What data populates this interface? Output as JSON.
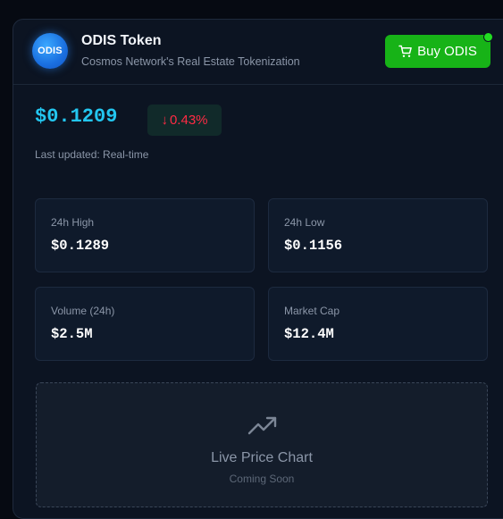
{
  "token": {
    "logo_text": "ODIS",
    "name": "ODIS Token",
    "subtitle": "Cosmos Network's Real Estate Tokenization"
  },
  "actions": {
    "buy_label": "Buy ODIS"
  },
  "price": {
    "value": "$0.1209",
    "change_arrow": "↓",
    "change_pct": "0.43%",
    "updated_label": "Last updated: Real-time"
  },
  "stats": [
    {
      "label": "24h High",
      "value": "$0.1289"
    },
    {
      "label": "24h Low",
      "value": "$0.1156"
    },
    {
      "label": "Volume (24h)",
      "value": "$2.5M"
    },
    {
      "label": "Market Cap",
      "value": "$12.4M"
    }
  ],
  "chart": {
    "title": "Live Price Chart",
    "subtitle": "Coming Soon",
    "icon": "trending-up-icon"
  },
  "colors": {
    "accent_price": "#23c6f0",
    "negative_change": "#ff2b44",
    "buy_button": "#17b317",
    "online_dot": "#22dd22"
  }
}
